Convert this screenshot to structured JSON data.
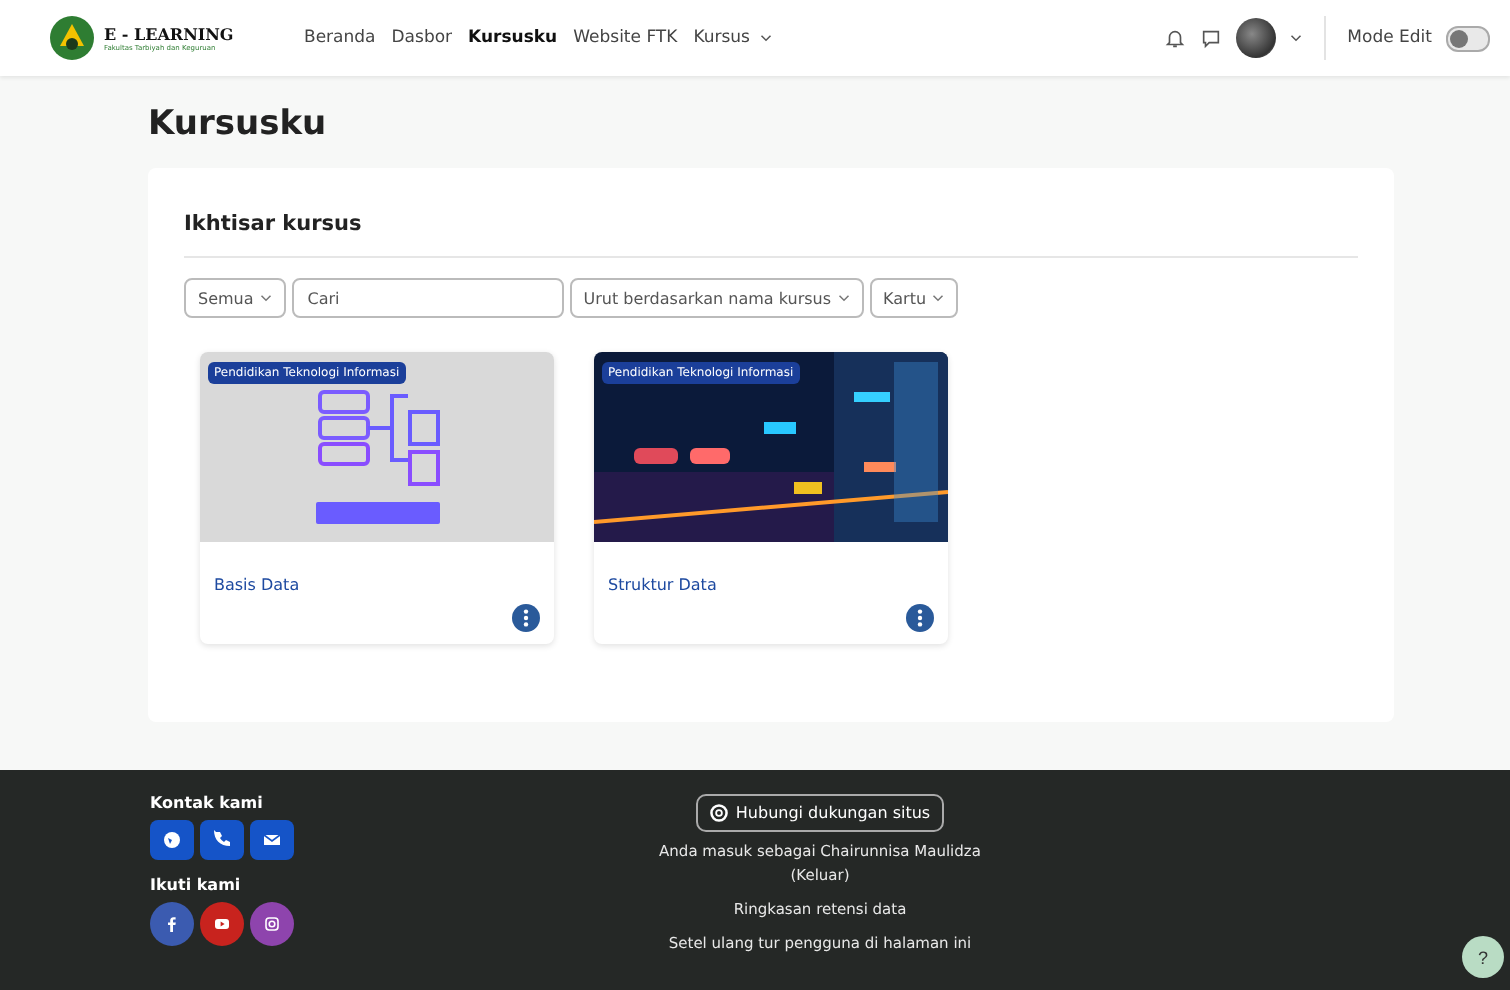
{
  "header": {
    "logo_title": "E - LEARNING",
    "logo_subtitle": "Fakultas Tarbiyah dan Keguruan",
    "nav": [
      {
        "label": "Beranda",
        "selected": false,
        "dropdown": false
      },
      {
        "label": "Dasbor",
        "selected": false,
        "dropdown": false
      },
      {
        "label": "Kursusku",
        "selected": true,
        "dropdown": false
      },
      {
        "label": "Website FTK",
        "selected": false,
        "dropdown": false
      },
      {
        "label": "Kursus",
        "selected": false,
        "dropdown": true
      }
    ],
    "edit_mode": {
      "label": "Mode Edit",
      "on": false
    }
  },
  "page_title": "Kursusku",
  "overview": {
    "title": "Ikhtisar kursus",
    "filters": [
      {
        "kind": "select",
        "value": "Semua"
      },
      {
        "kind": "search",
        "placeholder": "Cari"
      },
      {
        "kind": "select",
        "value": "Urut berdasarkan nama kursus"
      },
      {
        "kind": "select",
        "value": "Kartu"
      }
    ],
    "courses": [
      {
        "category": "Pendidikan Teknologi Informasi",
        "name": "Basis Data"
      },
      {
        "category": "Pendidikan Teknologi Informasi",
        "name": "Struktur Data"
      }
    ]
  },
  "footer": {
    "contact_title": "Kontak kami",
    "follow_title": "Ikuti kami",
    "support_button": "Hubungi dukungan situs",
    "logged_in_text": "Anda masuk sebagai Chairunnisa Maulidza",
    "logout_link": "(Keluar)",
    "links": [
      "Ringkasan retensi data",
      "Setel ulang tur pengguna di halaman ini"
    ],
    "help": "?"
  }
}
